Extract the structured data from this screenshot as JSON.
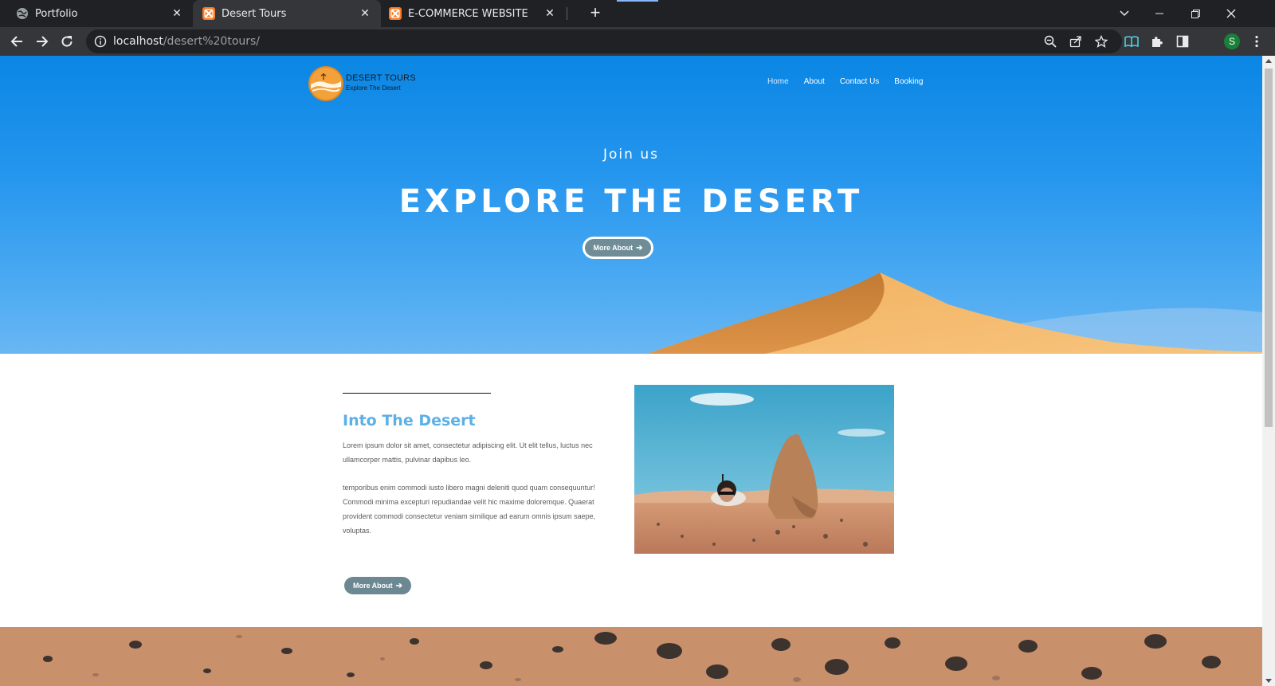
{
  "browser": {
    "tabs": [
      {
        "title": "Portfolio",
        "active": false,
        "icon": "globe-icon"
      },
      {
        "title": "Desert Tours",
        "active": true,
        "icon": "xampp-icon"
      },
      {
        "title": "E-COMMERCE WEBSITE",
        "active": false,
        "icon": "xampp-icon"
      }
    ],
    "url_host": "localhost",
    "url_path": "/desert%20tours/",
    "profile_initial": "S",
    "colors": {
      "chrome_dark": "#202124",
      "chrome_toolbar": "#35363a"
    }
  },
  "site": {
    "logo": {
      "brand": "DESERT TOURS",
      "tagline": "Explore The Desert"
    },
    "nav": [
      "Home",
      "About",
      "Contact Us",
      "Booking"
    ],
    "hero": {
      "kicker": "Join us",
      "headline": "EXPLORE THE DESERT",
      "button_label": "More About"
    },
    "about": {
      "title": "Into The Desert",
      "paragraph1": "Lorem ipsum dolor sit amet, consectetur adipiscing elit. Ut elit tellus, luctus nec ullamcorper mattis, pulvinar dapibus leo.",
      "paragraph2": "temporibus enim commodi iusto libero magni deleniti quod quam consequuntur! Commodi minima excepturi repudiandae velit hic maxime doloremque. Quaerat provident commodi consectetur veniam similique ad earum omnis ipsum saepe, voluptas.",
      "button_label": "More About"
    },
    "colors": {
      "sky": "#1a8fe9",
      "dune": "#e79c4c",
      "title_blue": "#5cb0e6",
      "button_slate": "#6c8993"
    }
  }
}
